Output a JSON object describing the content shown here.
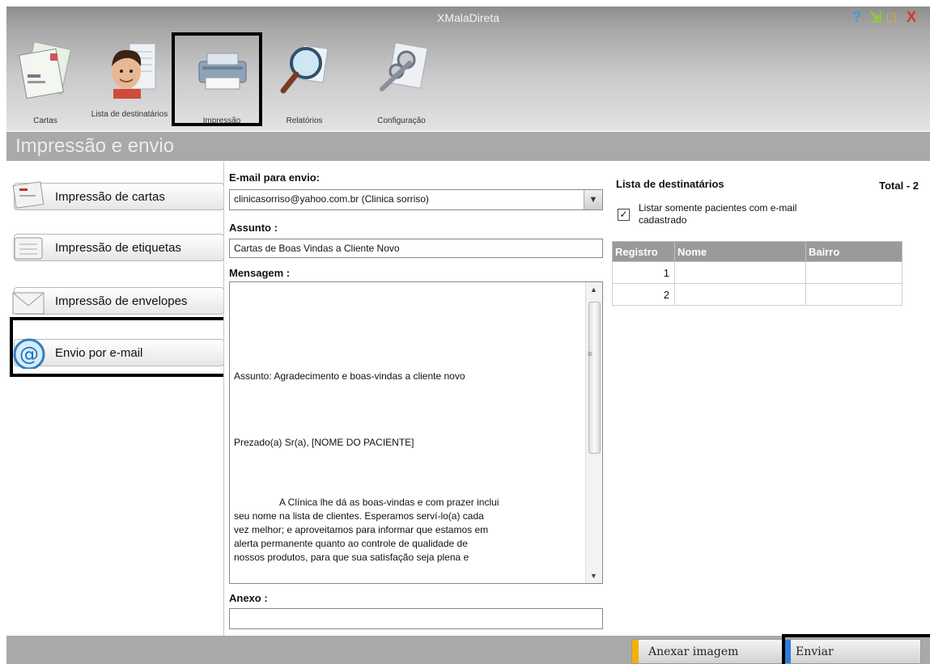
{
  "app": {
    "title": "XMalaDireta"
  },
  "window_controls": [
    {
      "name": "help-icon",
      "glyph": "?",
      "color": "#3aa0e0"
    },
    {
      "name": "minimize-icon",
      "glyph": "⇲",
      "color": "#8fd12b"
    },
    {
      "name": "maximize-icon",
      "glyph": "□",
      "color": "#e6b800"
    },
    {
      "name": "close-icon",
      "glyph": "X",
      "color": "#e0302a"
    }
  ],
  "toolbar": {
    "items": [
      {
        "label": "Cartas",
        "icon": "letters-icon"
      },
      {
        "label": "Lista de destinatários",
        "icon": "recipient-list-icon"
      },
      {
        "label": "Impressão",
        "icon": "printer-icon",
        "selected": true
      },
      {
        "label": "Relatórios",
        "icon": "magnifier-icon"
      },
      {
        "label": "Configuração",
        "icon": "tools-icon"
      }
    ]
  },
  "section": {
    "title": "Impressão e envio"
  },
  "sidebar": {
    "items": [
      {
        "label": "Impressão de cartas",
        "icon": "letter-icon"
      },
      {
        "label": "Impressão de etiquetas",
        "icon": "labels-icon"
      },
      {
        "label": "Impressão de envelopes",
        "icon": "envelope-icon"
      },
      {
        "label": "Envio por e-mail",
        "icon": "at-sign-icon",
        "selected": true
      }
    ]
  },
  "form": {
    "email_label": "E-mail para envio:",
    "email_value": "clinicasorriso@yahoo.com.br (Clinica sorriso)",
    "subject_label": "Assunto :",
    "subject_value": "Cartas de Boas Vindas a Cliente Novo",
    "message_label": "Mensagem :",
    "message_line1": "Assunto: Agradecimento e boas-vindas a cliente novo",
    "message_line2": "Prezado(a) Sr(a), [NOME DO PACIENTE]",
    "message_para_lines": [
      "A Clínica lhe dá as boas-vindas e com prazer inclui",
      "seu nome na lista de clientes. Esperamos serví-lo(a) cada",
      "vez melhor; e aproveitamos para informar que estamos em",
      "alerta permanente quanto ao controle de qualidade de",
      "nossos produtos, para que sua satisfação seja plena e"
    ],
    "attachment_label": "Anexo :",
    "attachment_value": ""
  },
  "recipients": {
    "title": "Lista de destinatários",
    "total": "Total - 2",
    "filter_label": "Listar somente pacientes com e-mail cadastrado",
    "filter_checked": true,
    "columns": [
      "Registro",
      "Nome",
      "Bairro"
    ],
    "rows": [
      {
        "registro": "1",
        "nome": "",
        "bairro": ""
      },
      {
        "registro": "2",
        "nome": "",
        "bairro": ""
      }
    ]
  },
  "bottom": {
    "attach_image_label": "Anexar imagem",
    "send_label": "Enviar",
    "attach_stripe_color": "#f2b200",
    "send_stripe_color": "#2a7fd4"
  }
}
